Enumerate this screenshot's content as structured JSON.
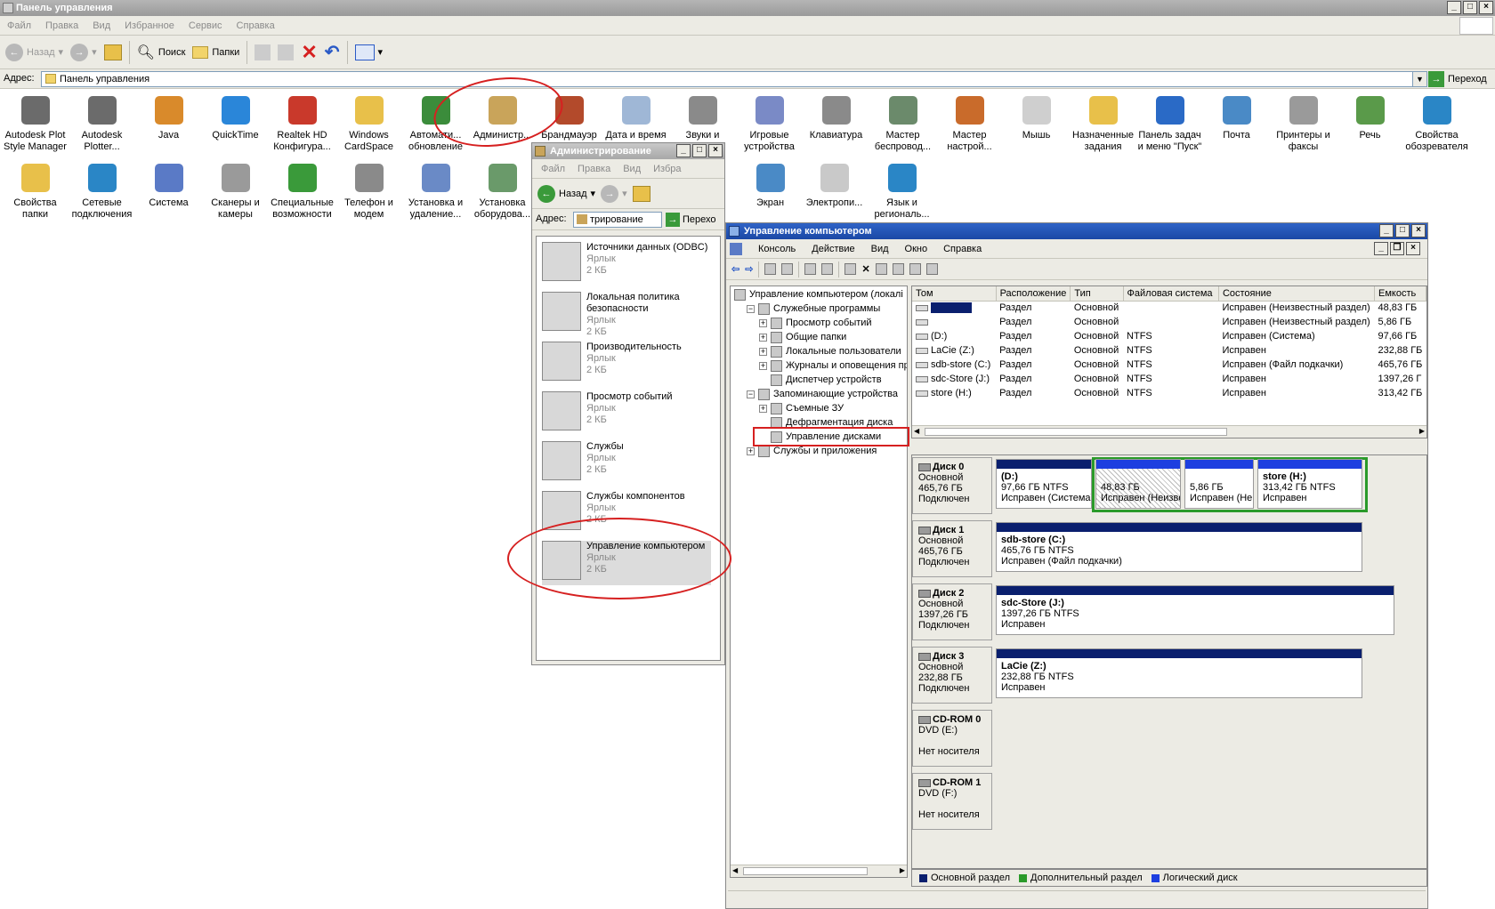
{
  "main_window": {
    "title": "Панель управления",
    "menu": [
      "Файл",
      "Правка",
      "Вид",
      "Избранное",
      "Сервис",
      "Справка"
    ],
    "toolbar": {
      "back": "Назад",
      "search": "Поиск",
      "folders": "Папки"
    },
    "address_label": "Адрес:",
    "address_value": "Панель управления",
    "go_label": "Переход"
  },
  "control_panel_icons": [
    {
      "label": "Autodesk Plot Style Manager",
      "icon": "autodesk-plot-icon",
      "color": "#6b6b6b"
    },
    {
      "label": "Autodesk Plotter...",
      "icon": "plotter-icon",
      "color": "#6b6b6b"
    },
    {
      "label": "Java",
      "icon": "java-icon",
      "color": "#d98a2b"
    },
    {
      "label": "QuickTime",
      "icon": "quicktime-icon",
      "color": "#2a86d9"
    },
    {
      "label": "Realtek HD Конфигура...",
      "icon": "realtek-icon",
      "color": "#c9392b"
    },
    {
      "label": "Windows CardSpace",
      "icon": "cardspace-icon",
      "color": "#e8c04a"
    },
    {
      "label": "Автомати... обновление",
      "icon": "update-icon",
      "color": "#3b8c3b"
    },
    {
      "label": "Администр...",
      "icon": "admin-tools-icon",
      "color": "#c9a45a"
    },
    {
      "label": "Брандмауэр",
      "icon": "firewall-icon",
      "color": "#b34a2b"
    },
    {
      "label": "Дата и время",
      "icon": "datetime-icon",
      "color": "#9fb7d6"
    },
    {
      "label": "Звуки и",
      "icon": "sound-icon",
      "color": "#8a8a8a"
    },
    {
      "label": "Игровые устройства",
      "icon": "gamepad-icon",
      "color": "#7a8ac6"
    },
    {
      "label": "Клавиатура",
      "icon": "keyboard-icon",
      "color": "#8a8a8a"
    },
    {
      "label": "Мастер беспровод...",
      "icon": "wireless-icon",
      "color": "#6b8a6b"
    },
    {
      "label": "Мастер настрой...",
      "icon": "network-wizard-icon",
      "color": "#c96b2b"
    },
    {
      "label": "Мышь",
      "icon": "mouse-icon",
      "color": "#cfcfcf"
    },
    {
      "label": "Назначенные задания",
      "icon": "tasks-icon",
      "color": "#e8c04a"
    },
    {
      "label": "Панель задач и меню \"Пуск\"",
      "icon": "taskbar-icon",
      "color": "#2a6ac6"
    },
    {
      "label": "Почта",
      "icon": "mail-icon",
      "color": "#4a8ac6"
    },
    {
      "label": "Принтеры и факсы",
      "icon": "printer-icon",
      "color": "#9a9a9a"
    },
    {
      "label": "Речь",
      "icon": "speech-icon",
      "color": "#5a9a4a"
    },
    {
      "label": "Свойства обозревателя",
      "icon": "ie-options-icon",
      "color": "#2a86c6"
    },
    {
      "label": "Свойства папки",
      "icon": "folder-options-icon",
      "color": "#e8c04a"
    },
    {
      "label": "Сетевые подключения",
      "icon": "network-icon",
      "color": "#2a86c6"
    },
    {
      "label": "Система",
      "icon": "system-icon",
      "color": "#5a7ac6"
    },
    {
      "label": "Сканеры и камеры",
      "icon": "scanner-icon",
      "color": "#9a9a9a"
    },
    {
      "label": "Специальные возможности",
      "icon": "accessibility-icon",
      "color": "#3a9a3a"
    },
    {
      "label": "Телефон и модем",
      "icon": "phone-icon",
      "color": "#8a8a8a"
    },
    {
      "label": "Установка и удаление...",
      "icon": "add-remove-icon",
      "color": "#6a8ac6"
    },
    {
      "label": "Установка оборудова...",
      "icon": "hardware-icon",
      "color": "#6a9a6a"
    },
    {
      "label": "Экран",
      "icon": "display-icon",
      "color": "#4a8ac6"
    },
    {
      "label": "Электропи...",
      "icon": "power-icon",
      "color": "#c9c9c9"
    },
    {
      "label": "Язык и региональ...",
      "icon": "language-icon",
      "color": "#2a86c6"
    }
  ],
  "admin_window": {
    "title": "Администрирование",
    "menu": [
      "Файл",
      "Правка",
      "Вид",
      "Избра"
    ],
    "back": "Назад",
    "address_label": "Адрес:",
    "address_value": "трирование",
    "go_label": "Перехо",
    "items": [
      {
        "name": "Источники данных (ODBC)",
        "type": "Ярлык",
        "size": "2 КБ",
        "icon": "odbc-icon"
      },
      {
        "name": "Локальная политика безопасности",
        "type": "Ярлык",
        "size": "2 КБ",
        "icon": "security-policy-icon"
      },
      {
        "name": "Производительность",
        "type": "Ярлык",
        "size": "2 КБ",
        "icon": "performance-icon"
      },
      {
        "name": "Просмотр событий",
        "type": "Ярлык",
        "size": "2 КБ",
        "icon": "event-viewer-icon"
      },
      {
        "name": "Службы",
        "type": "Ярлык",
        "size": "2 КБ",
        "icon": "services-icon"
      },
      {
        "name": "Службы компонентов",
        "type": "Ярлык",
        "size": "2 КБ",
        "icon": "component-services-icon"
      },
      {
        "name": "Управление компьютером",
        "type": "Ярлык",
        "size": "2 КБ",
        "icon": "computer-management-icon"
      }
    ]
  },
  "mgmt_window": {
    "title": "Управление компьютером",
    "menu": [
      "Консоль",
      "Действие",
      "Вид",
      "Окно",
      "Справка"
    ],
    "tree": [
      {
        "label": "Управление компьютером (локалі",
        "level": 0,
        "exp": ""
      },
      {
        "label": "Служебные программы",
        "level": 1,
        "exp": "−"
      },
      {
        "label": "Просмотр событий",
        "level": 2,
        "exp": "+"
      },
      {
        "label": "Общие папки",
        "level": 2,
        "exp": "+"
      },
      {
        "label": "Локальные пользователи",
        "level": 2,
        "exp": "+"
      },
      {
        "label": "Журналы и оповещения пр",
        "level": 2,
        "exp": "+"
      },
      {
        "label": "Диспетчер устройств",
        "level": 2,
        "exp": ""
      },
      {
        "label": "Запоминающие устройства",
        "level": 1,
        "exp": "−"
      },
      {
        "label": "Съемные ЗУ",
        "level": 2,
        "exp": "+"
      },
      {
        "label": "Дефрагментация диска",
        "level": 2,
        "exp": ""
      },
      {
        "label": "Управление дисками",
        "level": 2,
        "exp": ""
      },
      {
        "label": "Службы и приложения",
        "level": 1,
        "exp": "+"
      }
    ],
    "columns": [
      "Том",
      "Расположение",
      "Тип",
      "Файловая система",
      "Состояние",
      "Емкость"
    ],
    "volumes": [
      [
        "",
        "Раздел",
        "Основной",
        "",
        "Исправен (Неизвестный раздел)",
        "48,83 ГБ"
      ],
      [
        "",
        "Раздел",
        "Основной",
        "",
        "Исправен (Неизвестный раздел)",
        "5,86 ГБ"
      ],
      [
        "(D:)",
        "Раздел",
        "Основной",
        "NTFS",
        "Исправен (Система)",
        "97,66 ГБ"
      ],
      [
        "LaCie (Z:)",
        "Раздел",
        "Основной",
        "NTFS",
        "Исправен",
        "232,88 ГБ"
      ],
      [
        "sdb-store (C:)",
        "Раздел",
        "Основной",
        "NTFS",
        "Исправен (Файл подкачки)",
        "465,76 ГБ"
      ],
      [
        "sdc-Store (J:)",
        "Раздел",
        "Основной",
        "NTFS",
        "Исправен",
        "1397,26 Г"
      ],
      [
        "store (H:)",
        "Раздел",
        "Основной",
        "NTFS",
        "Исправен",
        "313,42 ГБ"
      ]
    ],
    "disks": [
      {
        "name": "Диск 0",
        "type": "Основной",
        "size": "465,76 ГБ",
        "status": "Подключен",
        "parts": [
          {
            "title": "(D:)",
            "size": "97,66 ГБ NTFS",
            "status": "Исправен (Система)",
            "kind": "primary"
          },
          {
            "title": "",
            "size": "48,83 ГБ",
            "status": "Исправен (Неизве",
            "kind": "hatch"
          },
          {
            "title": "",
            "size": "5,86 ГБ",
            "status": "Исправен (Неи",
            "kind": "logical"
          },
          {
            "title": "store (H:)",
            "size": "313,42 ГБ NTFS",
            "status": "Исправен",
            "kind": "logical"
          }
        ]
      },
      {
        "name": "Диск 1",
        "type": "Основной",
        "size": "465,76 ГБ",
        "status": "Подключен",
        "parts": [
          {
            "title": "sdb-store (C:)",
            "size": "465,76 ГБ NTFS",
            "status": "Исправен (Файл подкачки)",
            "kind": "primary"
          }
        ]
      },
      {
        "name": "Диск 2",
        "type": "Основной",
        "size": "1397,26 ГБ",
        "status": "Подключен",
        "parts": [
          {
            "title": "sdc-Store (J:)",
            "size": "1397,26 ГБ NTFS",
            "status": "Исправен",
            "kind": "primary"
          }
        ]
      },
      {
        "name": "Диск 3",
        "type": "Основной",
        "size": "232,88 ГБ",
        "status": "Подключен",
        "parts": [
          {
            "title": "LaCie (Z:)",
            "size": "232,88 ГБ NTFS",
            "status": "Исправен",
            "kind": "primary"
          }
        ]
      },
      {
        "name": "CD-ROM 0",
        "type": "DVD (E:)",
        "size": "",
        "status": "Нет носителя",
        "parts": []
      },
      {
        "name": "CD-ROM 1",
        "type": "DVD (F:)",
        "size": "",
        "status": "Нет носителя",
        "parts": []
      }
    ],
    "legend": [
      {
        "label": "Основной раздел",
        "color": "#0a1f6e"
      },
      {
        "label": "Дополнительный раздел",
        "color": "#2a9a2a"
      },
      {
        "label": "Логический диск",
        "color": "#1d3fe0"
      }
    ]
  }
}
